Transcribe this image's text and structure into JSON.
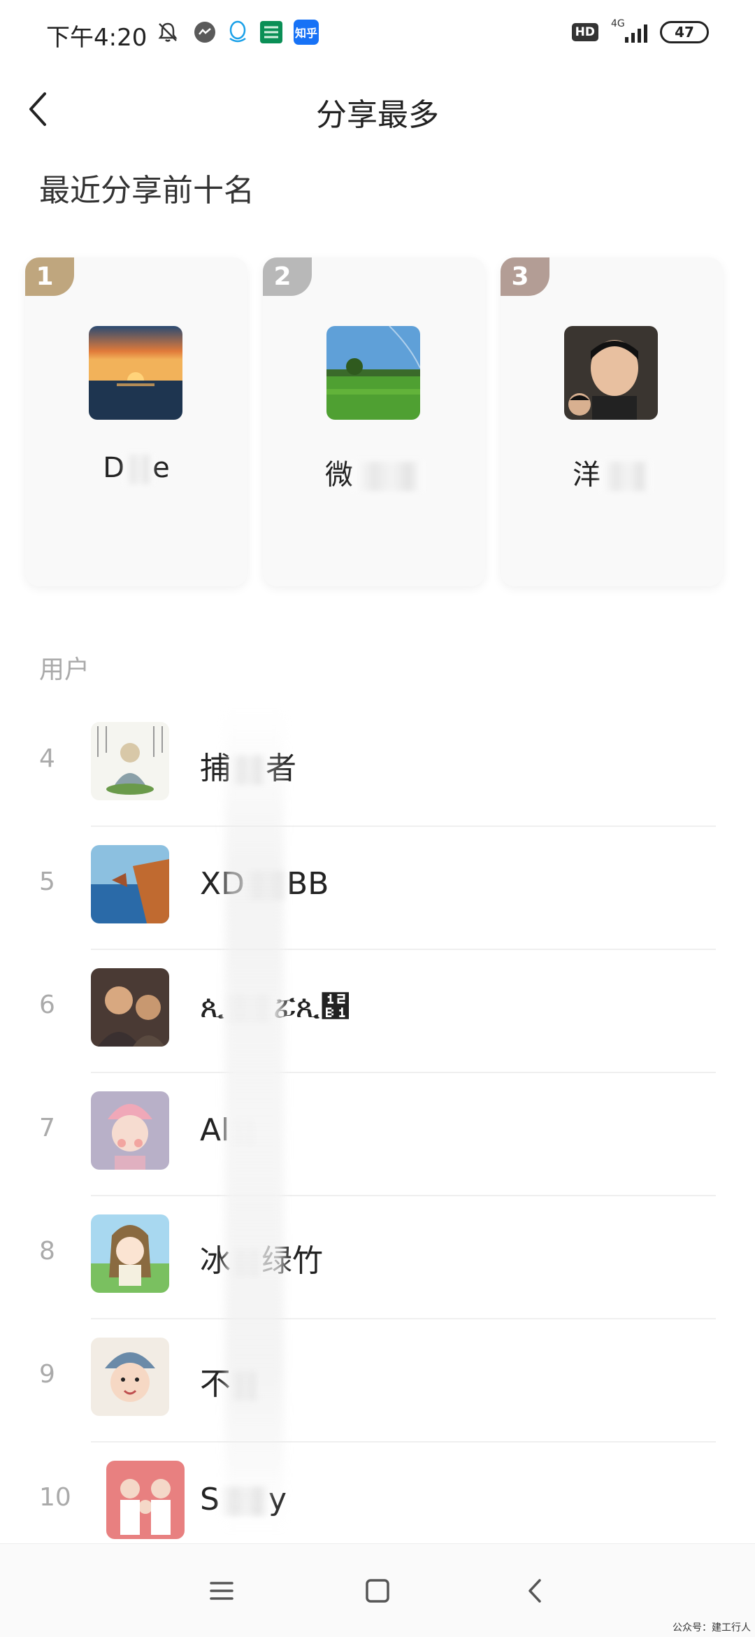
{
  "status_bar": {
    "time": "下午4:20",
    "icons_left": [
      "bell-off-icon",
      "chat-bubble-icon",
      "qq-icon",
      "china-post-icon",
      "zhihu-icon"
    ],
    "zhihu_label": "知乎",
    "hd_label": "HD",
    "network_label": "4G",
    "battery_level": "47"
  },
  "header": {
    "title": "分享最多"
  },
  "top_section": {
    "title": "最近分享前十名",
    "cards": [
      {
        "rank": "1",
        "name_prefix": "D",
        "name_suffix": "e",
        "badge_color": "#bfa67e"
      },
      {
        "rank": "2",
        "name_prefix": "微",
        "name_suffix": "",
        "badge_color": "#b8b8b8"
      },
      {
        "rank": "3",
        "name_prefix": "洋",
        "name_suffix": "",
        "badge_color": "#b39d95"
      }
    ]
  },
  "list_section": {
    "title": "用户",
    "rows": [
      {
        "rank": "4",
        "name": "捕",
        "name_tail": "者"
      },
      {
        "rank": "5",
        "name": "XD",
        "name_tail": "BB"
      },
      {
        "rank": "6",
        "name": "ጲ",
        "name_tail": "ፚጲ኱"
      },
      {
        "rank": "7",
        "name": "Al",
        "name_tail": ""
      },
      {
        "rank": "8",
        "name": "冰",
        "name_tail": "绿竹"
      },
      {
        "rank": "9",
        "name": "不",
        "name_tail": ""
      },
      {
        "rank": "10",
        "name": "S",
        "name_tail": "y"
      }
    ]
  },
  "nav_bar": {
    "buttons": [
      "menu-icon",
      "home-square-icon",
      "back-triangle-icon"
    ]
  },
  "watermark": "公众号：建工行人"
}
